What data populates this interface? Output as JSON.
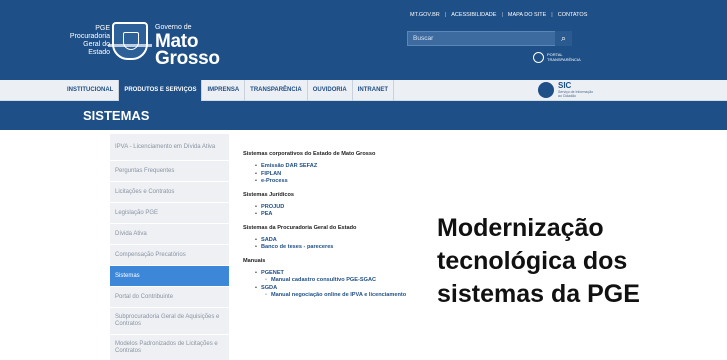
{
  "header": {
    "pge_lines": [
      "PGE",
      "Procuradoria",
      "Geral do",
      "Estado"
    ],
    "gov_small": "Governo de",
    "gov_big_lines": [
      "Mato",
      "Grosso"
    ],
    "top_links": [
      "MT.GOV.BR",
      "ACESSIBILIDADE",
      "MAPA DO SITE",
      "CONTATOS"
    ],
    "search_placeholder": "Buscar",
    "portal_lines": [
      "PORTAL",
      "TRANSPARÊNCIA"
    ]
  },
  "nav": {
    "items": [
      "INSTITUCIONAL",
      "PRODUTOS E SERVIÇOS",
      "IMPRENSA",
      "TRANSPARÊNCIA",
      "OUVIDORIA",
      "INTRANET"
    ],
    "active_index": 1,
    "sic_title": "SIC",
    "sic_sub_lines": [
      "Serviço de Informação",
      "ao Cidadão"
    ]
  },
  "page_title": "SISTEMAS",
  "sidebar": {
    "items": [
      {
        "label": "IPVA - Licenciamento em Dívida Ativa",
        "tall": true
      },
      {
        "label": "Perguntas Frequentes"
      },
      {
        "label": "Licitações e Contratos"
      },
      {
        "label": "Legislação PGE"
      },
      {
        "label": "Dívida Ativa"
      },
      {
        "label": "Compensação Precatórios"
      },
      {
        "label": "Sistemas",
        "active": true
      },
      {
        "label": "Portal do Contribuinte"
      },
      {
        "label": "Subprocuradoria Geral de Aquisições e Contratos",
        "tall": true
      },
      {
        "label": "Modelos Padronizados de Licitações e Contratos",
        "tall": true
      }
    ]
  },
  "content": {
    "sections": [
      {
        "title": "Sistemas corporativos do Estado de Mato Grosso",
        "items": [
          "Emissão DAR SEFAZ",
          "FIPLAN",
          "e-Process"
        ]
      },
      {
        "title": "Sistemas Jurídicos",
        "items": [
          "PROJUD",
          "PEA"
        ]
      },
      {
        "title": "Sistemas da Procuradoria Geral do Estado",
        "items": [
          "SADA",
          "Banco de teses - pareceres"
        ]
      },
      {
        "title": "Manuais",
        "items": [
          "PGENET",
          "SGDA"
        ],
        "subitems": {
          "PGENET": "Manual cadastro consultivo PGE-SGAC",
          "SGDA": "Manual negociação online de IPVA e licenciamento"
        }
      }
    ]
  },
  "overlay": {
    "lines": [
      "Modernização",
      "tecnológica dos",
      "sistemas da PGE"
    ]
  }
}
